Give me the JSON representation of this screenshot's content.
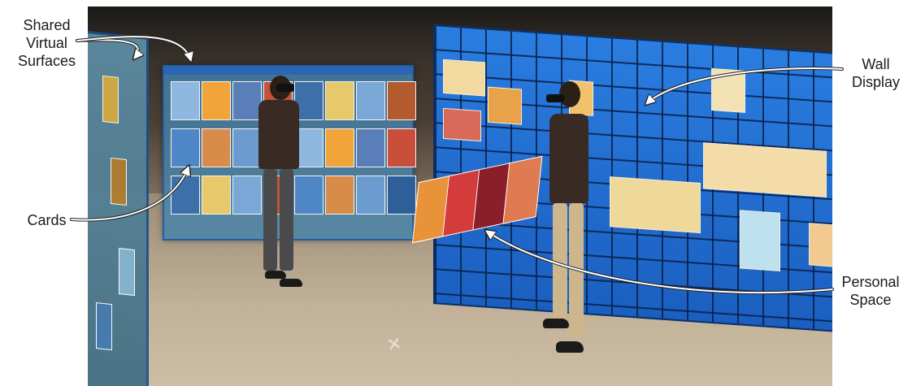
{
  "labels": {
    "shared_line1": "Shared",
    "shared_line2": "Virtual",
    "shared_line3": "Surfaces",
    "wall_line1": "Wall",
    "wall_line2": "Display",
    "cards": "Cards",
    "personal_line1": "Personal",
    "personal_line2": "Space"
  },
  "colors": {
    "wall_display": "#1f6fd1",
    "shared_surface": "#4682aa",
    "surface_border": "#1f5fa8",
    "arrow": "#ffffff"
  }
}
